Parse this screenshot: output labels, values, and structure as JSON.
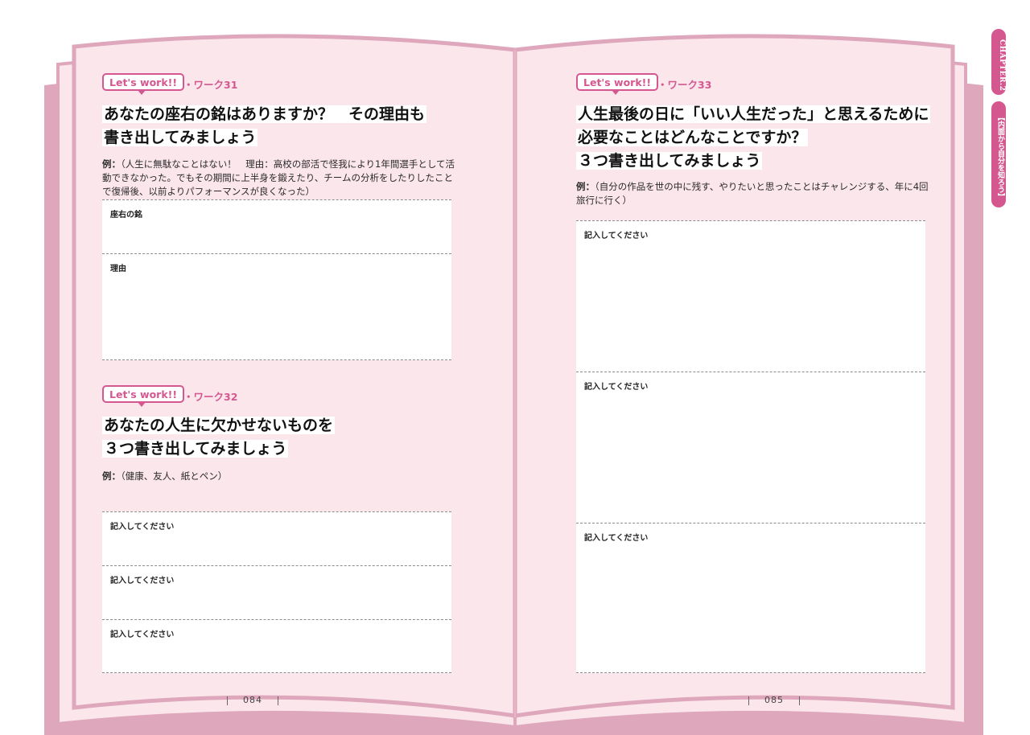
{
  "side_tabs": {
    "chapter": "CHAPTER.2",
    "topic": "【内面から自分を知ろう】"
  },
  "left_page": {
    "page_number": "084",
    "work31": {
      "badge": "Let's work!!",
      "work_no": "・ワーク31",
      "question_lines": [
        "あなたの座右の銘はありますか？　その理由も",
        "書き出してみましょう"
      ],
      "example_label": "例：",
      "example_text": "（人生に無駄なことはない！　理由：高校の部活で怪我により1年間選手として活動できなかった。でもその期間に上半身を鍛えたり、チームの分析をしたりしたことで復帰後、以前よりパフォーマンスが良くなった）",
      "fields": [
        "座右の銘",
        "理由"
      ]
    },
    "work32": {
      "badge": "Let's work!!",
      "work_no": "・ワーク32",
      "question_lines": [
        "あなたの人生に欠かせないものを",
        "３つ書き出してみましょう"
      ],
      "example_label": "例：",
      "example_text": "（健康、友人、紙とペン）",
      "fields": [
        "記入してください",
        "記入してください",
        "記入してください"
      ]
    }
  },
  "right_page": {
    "page_number": "085",
    "work33": {
      "badge": "Let's work!!",
      "work_no": "・ワーク33",
      "question_lines": [
        "人生最後の日に「いい人生だった」と思えるために",
        "必要なことはどんなことですか？",
        "３つ書き出してみましょう"
      ],
      "example_label": "例：",
      "example_text": "（自分の作品を世の中に残す、やりたいと思ったことはチャレンジする、年に4回旅行に行く）",
      "fields": [
        "記入してください",
        "記入してください",
        "記入してください"
      ]
    }
  },
  "colors": {
    "accent": "#d4588f",
    "book_pink": "#dea7bc",
    "page_pink": "#fbe6ec"
  }
}
